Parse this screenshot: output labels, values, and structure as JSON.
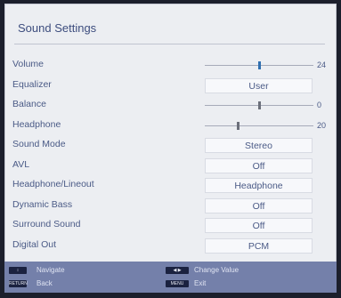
{
  "title": "Sound Settings",
  "settings": [
    {
      "label": "Volume",
      "type": "slider",
      "value": "24",
      "level": 0.5
    },
    {
      "label": "Equalizer",
      "type": "select",
      "value": "User"
    },
    {
      "label": "Balance",
      "type": "slider",
      "value": "0",
      "level": 0.5
    },
    {
      "label": "Headphone",
      "type": "slider",
      "value": "20",
      "level": 0.3
    },
    {
      "label": "Sound Mode",
      "type": "select",
      "value": "Stereo"
    },
    {
      "label": "AVL",
      "type": "select",
      "value": "Off"
    },
    {
      "label": "Headphone/Lineout",
      "type": "select",
      "value": "Headphone"
    },
    {
      "label": "Dynamic Bass",
      "type": "select",
      "value": "Off"
    },
    {
      "label": "Surround Sound",
      "type": "select",
      "value": "Off"
    },
    {
      "label": "Digital Out",
      "type": "select",
      "value": "PCM"
    }
  ],
  "footer": {
    "navigate_key": "↕",
    "navigate_label": "Navigate",
    "change_key": "◀ ▶",
    "change_label": "Change Value",
    "back_key": "RETURN",
    "back_label": "Back",
    "exit_key": "MENU",
    "exit_label": "Exit"
  },
  "colors": {
    "panel": "#eceef2",
    "text": "#4a5a86",
    "footer": "#7480aa",
    "thumb_primary": "#2f6fb0",
    "thumb_secondary": "#6b6f7a"
  }
}
